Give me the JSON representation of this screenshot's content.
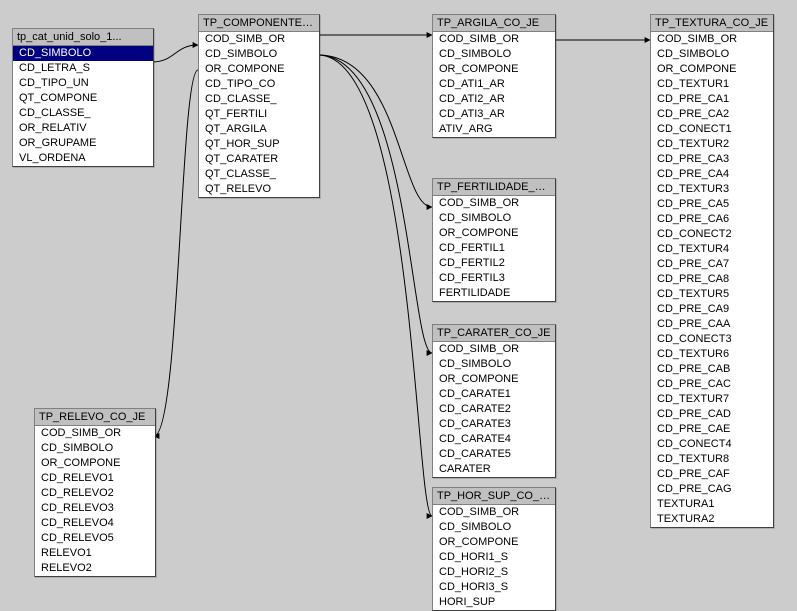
{
  "tables": [
    {
      "title": "tp_cat_unid_solo_1...",
      "selected": "CD_SIMBOLO",
      "fields": [
        "CD_SIMBOLO",
        "CD_LETRA_S",
        "CD_TIPO_UN",
        "QT_COMPONE",
        "CD_CLASSE_",
        "OR_RELATIV",
        "OR_GRUPAME",
        "VL_ORDENA"
      ]
    },
    {
      "title": "TP_COMPONENTE_JE",
      "fields": [
        "COD_SIMB_OR",
        "CD_SIMBOLO",
        "OR_COMPONE",
        "CD_TIPO_CO",
        "CD_CLASSE_",
        "QT_FERTILI",
        "QT_ARGILA",
        "QT_HOR_SUP",
        "QT_CARATER",
        "QT_CLASSE_",
        "QT_RELEVO"
      ]
    },
    {
      "title": "TP_ARGILA_CO_JE",
      "fields": [
        "COD_SIMB_OR",
        "CD_SIMBOLO",
        "OR_COMPONE",
        "CD_ATI1_AR",
        "CD_ATI2_AR",
        "CD_ATI3_AR",
        "ATIV_ARG"
      ]
    },
    {
      "title": "TP_FERTILIDADE_CO...",
      "fields": [
        "COD_SIMB_OR",
        "CD_SIMBOLO",
        "OR_COMPONE",
        "CD_FERTIL1",
        "CD_FERTIL2",
        "CD_FERTIL3",
        "FERTILIDADE"
      ]
    },
    {
      "title": "TP_CARATER_CO_JE",
      "fields": [
        "COD_SIMB_OR",
        "CD_SIMBOLO",
        "OR_COMPONE",
        "CD_CARATE1",
        "CD_CARATE2",
        "CD_CARATE3",
        "CD_CARATE4",
        "CD_CARATE5",
        "CARATER"
      ]
    },
    {
      "title": "TP_HOR_SUP_CO_JE",
      "fields": [
        "COD_SIMB_OR",
        "CD_SIMBOLO",
        "OR_COMPONE",
        "CD_HORI1_S",
        "CD_HORI2_S",
        "CD_HORI3_S",
        "HORI_SUP"
      ]
    },
    {
      "title": "TP_RELEVO_CO_JE",
      "fields": [
        "COD_SIMB_OR",
        "CD_SIMBOLO",
        "OR_COMPONE",
        "CD_RELEVO1",
        "CD_RELEVO2",
        "CD_RELEVO3",
        "CD_RELEVO4",
        "CD_RELEVO5",
        "RELEVO1",
        "RELEVO2"
      ]
    },
    {
      "title": "TP_TEXTURA_CO_JE",
      "fields": [
        "COD_SIMB_OR",
        "CD_SIMBOLO",
        "OR_COMPONE",
        "CD_TEXTUR1",
        "CD_PRE_CA1",
        "CD_PRE_CA2",
        "CD_CONECT1",
        "CD_TEXTUR2",
        "CD_PRE_CA3",
        "CD_PRE_CA4",
        "CD_TEXTUR3",
        "CD_PRE_CA5",
        "CD_PRE_CA6",
        "CD_CONECT2",
        "CD_TEXTUR4",
        "CD_PRE_CA7",
        "CD_PRE_CA8",
        "CD_TEXTUR5",
        "CD_PRE_CA9",
        "CD_PRE_CAA",
        "CD_CONECT3",
        "CD_TEXTUR6",
        "CD_PRE_CAB",
        "CD_PRE_CAC",
        "CD_TEXTUR7",
        "CD_PRE_CAD",
        "CD_PRE_CAE",
        "CD_CONECT4",
        "CD_TEXTUR8",
        "CD_PRE_CAF",
        "CD_PRE_CAG",
        "TEXTURA1",
        "TEXTURA2"
      ]
    }
  ]
}
